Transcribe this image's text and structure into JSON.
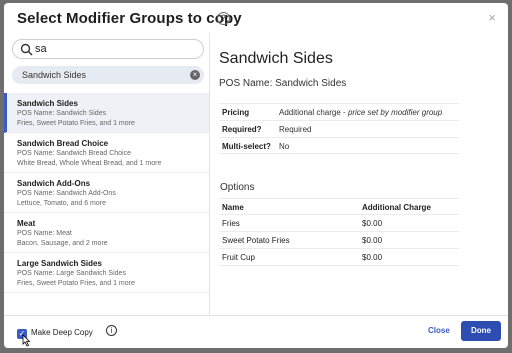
{
  "dialog": {
    "title": "Select Modifier Groups to copy",
    "help_icon": "?",
    "close_icon": "×"
  },
  "search": {
    "value": "sa",
    "placeholder": ""
  },
  "filter_chip": {
    "label": "Sandwich Sides",
    "clear_icon": "×"
  },
  "groups": [
    {
      "name": "Sandwich Sides",
      "pos": "POS Name: Sandwich Sides",
      "items": "Fries, Sweet Potato Fries, and 1 more",
      "selected": true
    },
    {
      "name": "Sandwich Bread Choice",
      "pos": "POS Name: Sandwich Bread Choice",
      "items": "White Bread, Whole Wheat Bread, and 1 more",
      "selected": false
    },
    {
      "name": "Sandwich Add-Ons",
      "pos": "POS Name: Sandwich Add-Ons",
      "items": "Lettuce, Tomato, and 6 more",
      "selected": false
    },
    {
      "name": "Meat",
      "pos": "POS Name: Meat",
      "items": "Bacon, Sausage, and 2 more",
      "selected": false
    },
    {
      "name": "Large Sandwich Sides",
      "pos": "POS Name: Large Sandwich Sides",
      "items": "Fries, Sweet Potato Fries, and 1 more",
      "selected": false
    }
  ],
  "detail": {
    "title": "Sandwich Sides",
    "pos_name": "POS Name: Sandwich Sides",
    "properties": {
      "pricing": {
        "label": "Pricing",
        "value": "Additional charge - ",
        "value_italic": "price set by modifier group"
      },
      "required": {
        "label": "Required?",
        "value": "Required"
      },
      "multi": {
        "label": "Multi-select?",
        "value": "No"
      }
    },
    "options_label": "Options",
    "options_table": {
      "headers": [
        "Name",
        "Additional Charge"
      ],
      "rows": [
        [
          "Fries",
          "$0.00"
        ],
        [
          "Sweet Potato Fries",
          "$0.00"
        ],
        [
          "Fruit Cup",
          "$0.00"
        ]
      ]
    }
  },
  "footer": {
    "deep_copy_label": "Make Deep Copy",
    "deep_copy_checked": true,
    "info_icon": "i",
    "close_label": "Close",
    "done_label": "Done"
  },
  "colors": {
    "accent": "#3a5bc7",
    "done_bg": "#2e4db0",
    "backdrop": "#6e6e6e"
  }
}
